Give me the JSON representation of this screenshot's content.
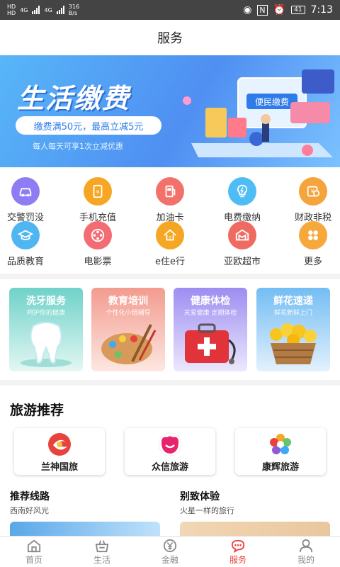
{
  "status": {
    "carrier1": "HD",
    "carrier2": "HD",
    "net1": "4G",
    "net2": "4G",
    "speed": "316 B/s",
    "battery": "41",
    "time": "7:13"
  },
  "header": {
    "title": "服务"
  },
  "banner": {
    "title": "生活缴费",
    "pill": "缴费满50元，最高立减5元",
    "sub": "每人每天可享1次立减优惠",
    "card_text": "便民缴费"
  },
  "services": [
    {
      "label": "交警罚没",
      "icon": "car-icon",
      "color": "#8e7cf4"
    },
    {
      "label": "手机充值",
      "icon": "phone-recharge-icon",
      "color": "#f6a623"
    },
    {
      "label": "加油卡",
      "icon": "fuel-card-icon",
      "color": "#f2716b"
    },
    {
      "label": "电费缴纳",
      "icon": "lightbulb-icon",
      "color": "#4fbdf5"
    },
    {
      "label": "财政非税",
      "icon": "finance-icon",
      "color": "#f5a43c"
    },
    {
      "label": "品质教育",
      "icon": "graduation-cap-icon",
      "color": "#4fb6f2"
    },
    {
      "label": "电影票",
      "icon": "film-reel-icon",
      "color": "#f36b73"
    },
    {
      "label": "e住e行",
      "icon": "house-icon",
      "color": "#f5a623"
    },
    {
      "label": "亚欧超市",
      "icon": "store-icon",
      "color": "#ef6b62"
    },
    {
      "label": "更多",
      "icon": "more-icon",
      "color": "#f6a83b"
    }
  ],
  "promo_cards": [
    {
      "title": "洗牙服务",
      "sub": "呵护你的健康",
      "color": "#6fd2c9"
    },
    {
      "title": "教育培训",
      "sub": "个性化小组辅导",
      "color": "#f39b8f"
    },
    {
      "title": "健康体检",
      "sub": "关爱健康  定期体检",
      "color": "#9d8df1"
    },
    {
      "title": "鲜花速递",
      "sub": "鲜花新鲜上门",
      "color": "#73bdf3"
    }
  ],
  "travel": {
    "heading": "旅游推荐",
    "agencies": [
      {
        "name": "兰神国旅"
      },
      {
        "name": "众信旅游"
      },
      {
        "name": "康辉旅游"
      }
    ],
    "left_title": "推荐线路",
    "left_sub": "西南好风光",
    "right_title": "别致体验",
    "right_sub": "火星一样的旅行"
  },
  "tabs": [
    {
      "label": "首页",
      "icon": "home-icon"
    },
    {
      "label": "生活",
      "icon": "basket-icon"
    },
    {
      "label": "金融",
      "icon": "yen-icon"
    },
    {
      "label": "服务",
      "icon": "chat-icon",
      "active": true
    },
    {
      "label": "我的",
      "icon": "person-icon"
    }
  ]
}
